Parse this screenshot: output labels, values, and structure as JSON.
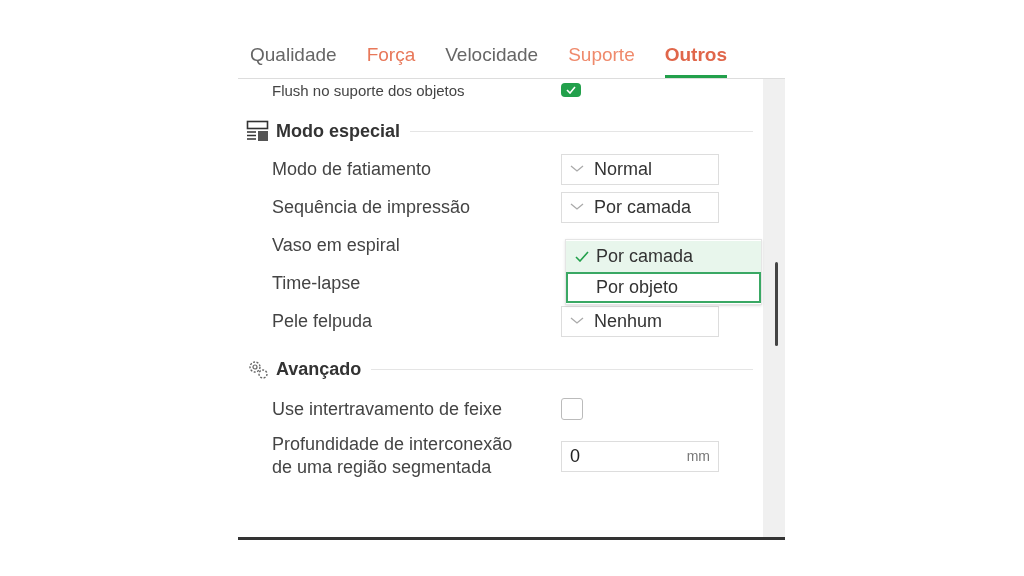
{
  "tabs": [
    {
      "label": "Qualidade",
      "selected": false,
      "color": "#666666"
    },
    {
      "label": "Força",
      "selected": false,
      "color": "#e8785a"
    },
    {
      "label": "Velocidade",
      "selected": false,
      "color": "#666666"
    },
    {
      "label": "Suporte",
      "selected": false,
      "color": "#ef8a6c"
    },
    {
      "label": "Outros",
      "selected": true,
      "color": "#e0664a"
    }
  ],
  "top_row": {
    "label": "Flush no suporte dos objetos",
    "checked": true
  },
  "sections": [
    {
      "title": "Modo especial",
      "kind": "layout",
      "rows": [
        {
          "label": "Modo de fatiamento",
          "kind": "select",
          "value": "Normal"
        },
        {
          "label": "Sequência de impressão",
          "kind": "select",
          "value": "Por camada"
        },
        {
          "label": "Vaso em espiral",
          "kind": "covered"
        },
        {
          "label": "Time-lapse",
          "kind": "covered"
        },
        {
          "label": "Pele felpuda",
          "kind": "select",
          "value": "Nenhum"
        }
      ]
    },
    {
      "title": "Avançado",
      "kind": "gears",
      "rows": [
        {
          "label": "Use intertravamento de feixe",
          "kind": "checkbox",
          "checked": false
        },
        {
          "label": "Profundidade de interconexão de uma região segmentada",
          "kind": "number",
          "value": "0",
          "unit": "mm"
        }
      ]
    }
  ],
  "dropdown": {
    "options": [
      {
        "label": "Por camada",
        "selected": true,
        "focused": false
      },
      {
        "label": "Por objeto",
        "selected": false,
        "focused": true
      }
    ]
  }
}
